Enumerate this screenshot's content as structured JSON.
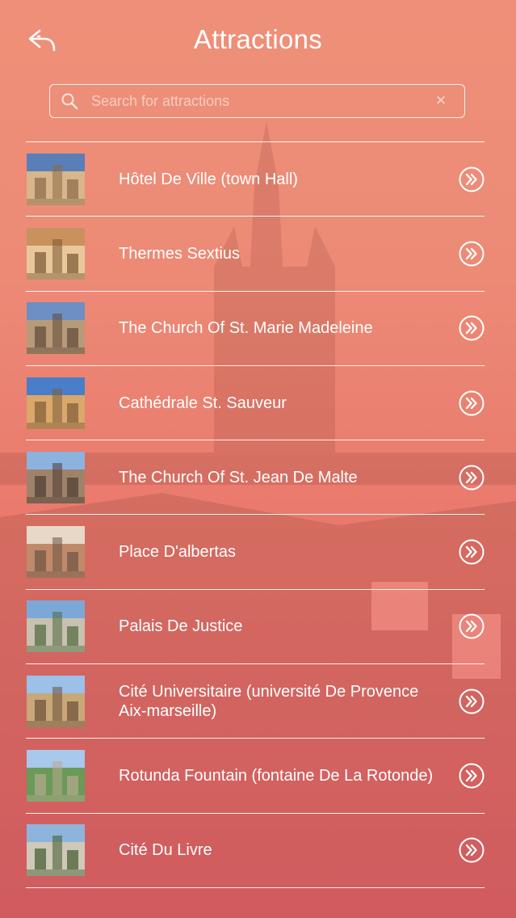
{
  "header": {
    "title": "Attractions",
    "back_icon": "back-arrow-icon"
  },
  "search": {
    "placeholder": "Search for attractions",
    "value": ""
  },
  "colors": {
    "bg_top": "#ee9079",
    "bg_bottom": "#e4646a",
    "foreground": "#ffffff"
  },
  "attractions": [
    {
      "name": "Hôtel De Ville (town Hall)",
      "thumb": [
        "#5a7fb8",
        "#d8b58a",
        "#8a6a48"
      ]
    },
    {
      "name": "Thermes Sextius",
      "thumb": [
        "#c9925c",
        "#e8c89a",
        "#7a5532"
      ]
    },
    {
      "name": "The Church Of St. Marie Madeleine",
      "thumb": [
        "#6d8fc4",
        "#b89a78",
        "#5e4a38"
      ]
    },
    {
      "name": "Cathédrale St. Sauveur",
      "thumb": [
        "#4a7ec8",
        "#d9a86a",
        "#7f5c3a"
      ]
    },
    {
      "name": "The Church Of St. Jean De Malte",
      "thumb": [
        "#8cb2e0",
        "#a0826a",
        "#4c3c30"
      ]
    },
    {
      "name": "Place D'albertas",
      "thumb": [
        "#e8d8c8",
        "#c08a6a",
        "#6e5444"
      ]
    },
    {
      "name": "Palais De Justice",
      "thumb": [
        "#7ca8d8",
        "#c8c0b0",
        "#4e6a3c"
      ]
    },
    {
      "name": "Cité Universitaire (université De Provence Aix-marseille)",
      "thumb": [
        "#9cc0e8",
        "#c8a878",
        "#6a5038"
      ]
    },
    {
      "name": "Rotunda Fountain (fontaine De La Rotonde)",
      "thumb": [
        "#a8c8ec",
        "#6a9a58",
        "#b8a890"
      ]
    },
    {
      "name": "Cité Du Livre",
      "thumb": [
        "#8fb4dc",
        "#d0c8b8",
        "#3e5a2c"
      ]
    }
  ]
}
